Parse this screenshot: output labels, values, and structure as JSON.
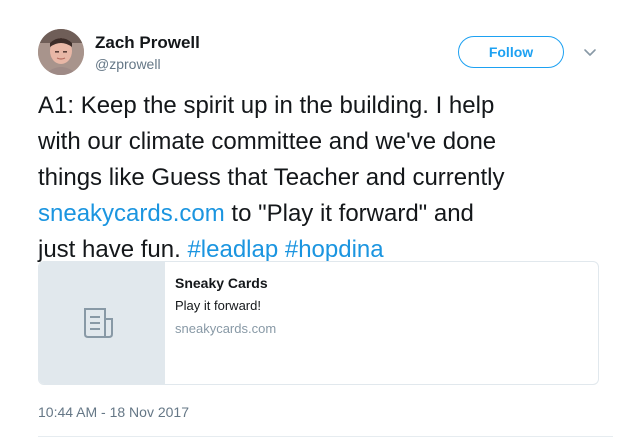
{
  "user": {
    "name": "Zach Prowell",
    "handle": "@zprowell"
  },
  "header": {
    "follow_label": "Follow"
  },
  "tweet": {
    "lines": [
      [
        {
          "text": "A1: Keep the spirit up in the building. I help",
          "link": false
        }
      ],
      [
        {
          "text": "with our climate committee and we've done",
          "link": false
        }
      ],
      [
        {
          "text": "things like Guess that Teacher and currently",
          "link": false
        }
      ],
      [
        {
          "text": "sneakycards.com",
          "link": true
        },
        {
          "text": " to \"Play it forward\" and",
          "link": false
        }
      ],
      [
        {
          "text": "just have fun. ",
          "link": false
        },
        {
          "text": "#leadlap",
          "link": true
        },
        {
          "text": " ",
          "link": false
        },
        {
          "text": "#hopdina",
          "link": true
        }
      ]
    ],
    "timestamp": "10:44 AM - 18 Nov 2017"
  },
  "card": {
    "title": "Sneaky Cards",
    "description": "Play it forward!",
    "domain": "sneakycards.com"
  },
  "colors": {
    "accent": "#1da1f2",
    "link": "#1b95e0",
    "secondary_text": "#657786"
  },
  "icons": {
    "caret": "chevron-down-icon",
    "card_placeholder": "document-icon"
  }
}
